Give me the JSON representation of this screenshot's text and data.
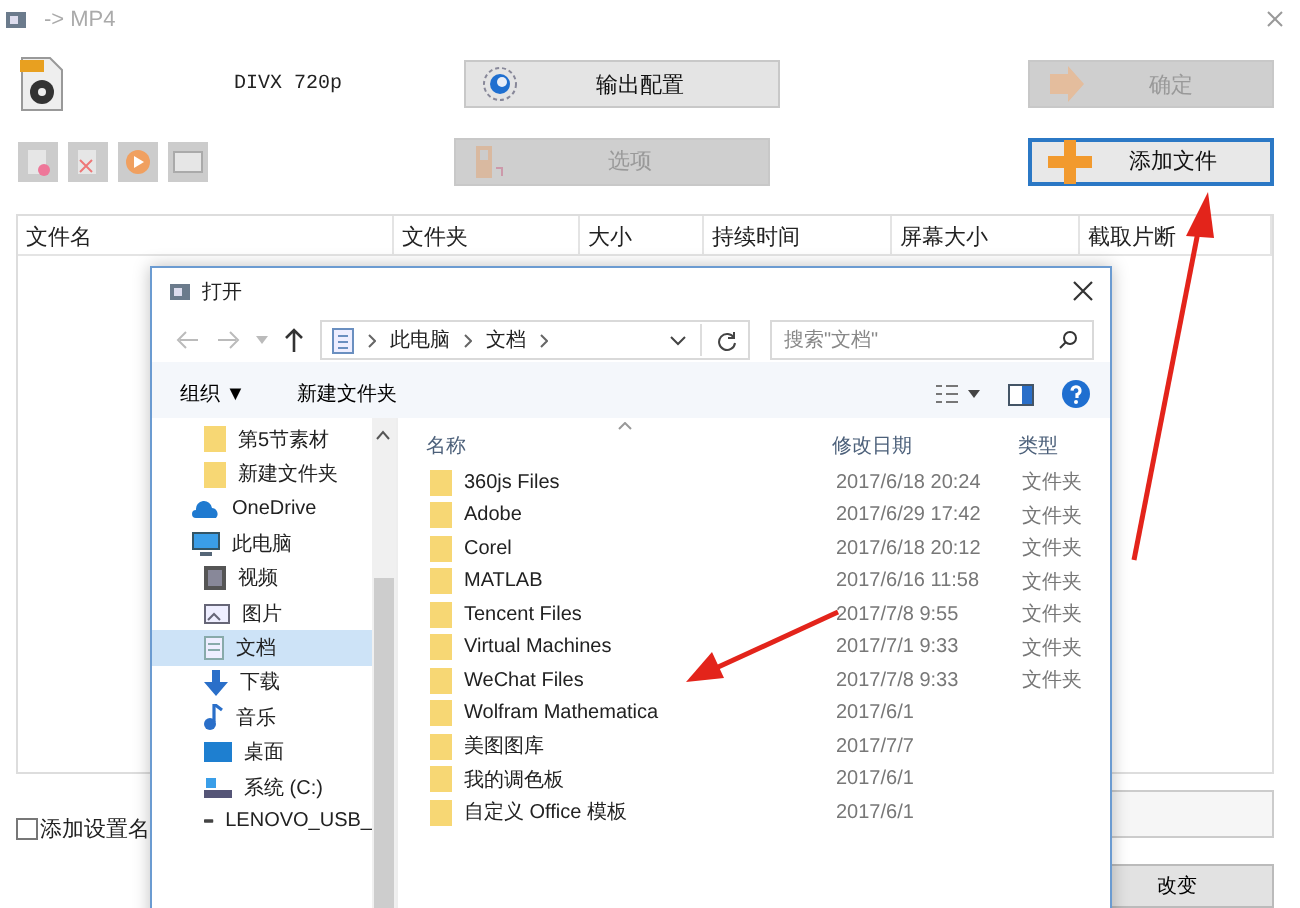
{
  "window": {
    "title": "-> MP4"
  },
  "profile": {
    "label": "DIVX 720p"
  },
  "buttons_top": [
    {
      "label": "输出配置",
      "disabled": false,
      "kind": "gear"
    },
    {
      "label": "确定",
      "disabled": true,
      "kind": "arrow"
    }
  ],
  "buttons_second": [
    {
      "label": "选项",
      "disabled": true,
      "kind": "film"
    },
    {
      "label": "添加文件",
      "disabled": false,
      "kind": "plus"
    }
  ],
  "table": {
    "columns": [
      "文件名",
      "文件夹",
      "大小",
      "持续时间",
      "屏幕大小",
      "截取片断"
    ]
  },
  "options": {
    "checkbox_label": "添加设置名",
    "checked": false
  },
  "change_button": {
    "label": "改变"
  },
  "dialog": {
    "title": "打开",
    "breadcrumb": [
      "此电脑",
      "文档"
    ],
    "search": {
      "placeholder": "搜索\"文档\""
    },
    "toolbar": {
      "organize": "组织 ▼",
      "new_folder": "新建文件夹"
    },
    "nav_pane": [
      {
        "label": "第5节素材",
        "kind": "folder",
        "selected": false
      },
      {
        "label": "新建文件夹",
        "kind": "folder",
        "selected": false
      },
      {
        "label": "OneDrive",
        "kind": "cloud",
        "selected": false
      },
      {
        "label": "此电脑",
        "kind": "pc",
        "selected": false,
        "children": [
          {
            "label": "视频",
            "kind": "video",
            "selected": false
          },
          {
            "label": "图片",
            "kind": "picture",
            "selected": false
          },
          {
            "label": "文档",
            "kind": "doc",
            "selected": true
          },
          {
            "label": "下载",
            "kind": "download",
            "selected": false
          },
          {
            "label": "音乐",
            "kind": "music",
            "selected": false
          },
          {
            "label": "桌面",
            "kind": "desktop",
            "selected": false
          },
          {
            "label": "系统 (C:)",
            "kind": "drive",
            "selected": false
          },
          {
            "label": "LENOVO_USB_",
            "kind": "usb",
            "selected": false
          }
        ]
      }
    ],
    "columns": [
      "名称",
      "修改日期",
      "类型"
    ],
    "files": [
      {
        "name": "360js Files",
        "date": "2017/6/18 20:24",
        "type": "文件夹"
      },
      {
        "name": "Adobe",
        "date": "2017/6/29 17:42",
        "type": "文件夹"
      },
      {
        "name": "Corel",
        "date": "2017/6/18 20:12",
        "type": "文件夹"
      },
      {
        "name": "MATLAB",
        "date": "2017/6/16 11:58",
        "type": "文件夹"
      },
      {
        "name": "Tencent Files",
        "date": "2017/7/8 9:55",
        "type": "文件夹"
      },
      {
        "name": "Virtual Machines",
        "date": "2017/7/1 9:33",
        "type": "文件夹"
      },
      {
        "name": "WeChat Files",
        "date": "2017/7/8 9:33",
        "type": "文件夹"
      },
      {
        "name": "Wolfram Mathematica",
        "date": "2017/6/1"
      },
      {
        "name": "美图图库",
        "date": "2017/7/7"
      },
      {
        "name": "我的调色板",
        "date": "2017/6/1"
      },
      {
        "name": "自定义 Office 模板",
        "date": "2017/6/1"
      }
    ]
  }
}
